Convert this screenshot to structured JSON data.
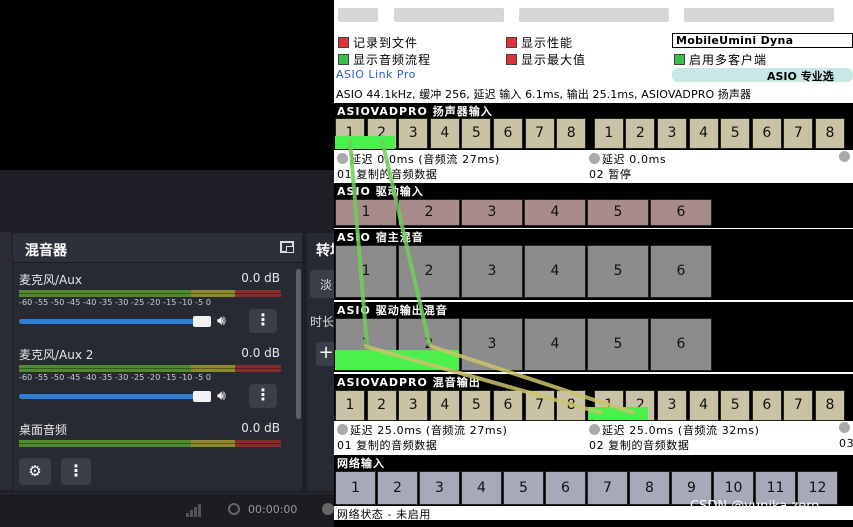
{
  "obs": {
    "mixer": {
      "title": "混音器",
      "channels": [
        {
          "name": "麦克风/Aux",
          "db": "0.0 dB"
        },
        {
          "name": "麦克风/Aux 2",
          "db": "0.0 dB"
        },
        {
          "name": "桌面音频",
          "db": "0.0 dB"
        }
      ],
      "scale": "-60 -55 -50 -45 -40 -35 -30 -25 -20 -15 -10 -5 0"
    },
    "transitions": {
      "title": "转场",
      "selected": "淡",
      "duration_label": "时长"
    },
    "status": {
      "time": "00:00:00"
    }
  },
  "asio": {
    "options": {
      "record": "记录到文件",
      "show_perf": "显示性能",
      "show_flow": "显示音频流程",
      "show_max": "显示最大值",
      "multi_client": "启用多客户端",
      "device": "MobileUmini Dyna",
      "link_pro": "ASIO Link Pro",
      "pro_button": "ASIO 专业选"
    },
    "info": "ASIO 44.1kHz, 缓冲 256, 延迟 输入 6.1ms, 输出 25.1ms, ASIOVADPRO 扬声器",
    "sections": {
      "speaker_in": "ASIOVADPRO 扬声器输入",
      "driver_in": "ASIO 驱动输入",
      "host_mix": "ASIO 宿主混音",
      "driver_out_mix": "ASIO 驱动输出混音",
      "mix_out": "ASIOVADPRO 混音输出",
      "net_in": "网络输入"
    },
    "speaker_in_status": {
      "a_latency": "延迟 0.0ms (音频流 27ms)",
      "a_source": "01 复制的音频数据",
      "b_latency": "延迟 0.0ms",
      "b_source": "02 暂停"
    },
    "mix_out_status": {
      "a_latency": "延迟 25.0ms (音频流 27ms)",
      "a_source": "01 复制的音频数据",
      "b_latency": "延迟 25.0ms (音频流 32ms)",
      "b_source": "02 复制的音频数据",
      "c_prefix": "03"
    },
    "net_status": "网络状态 - 未启用",
    "net_channels": [
      "1",
      "2",
      "3",
      "4",
      "5",
      "6",
      "7",
      "8",
      "9",
      "10",
      "11",
      "12"
    ],
    "eight": [
      "1",
      "2",
      "3",
      "4",
      "5",
      "6",
      "7",
      "8"
    ],
    "six": [
      "1",
      "2",
      "3",
      "4",
      "5",
      "6"
    ]
  },
  "watermark": "CSDN @yunika zero",
  "colors": {
    "route_green": "#4cf04c",
    "route_line_green": "#6fcf5a",
    "route_line_yellow": "#c9c46a",
    "meter_green": "#4f8a2e",
    "meter_yellow": "#8d8a2a",
    "meter_red": "#8a2c2c",
    "slider_blue": "#2f7fd8"
  }
}
